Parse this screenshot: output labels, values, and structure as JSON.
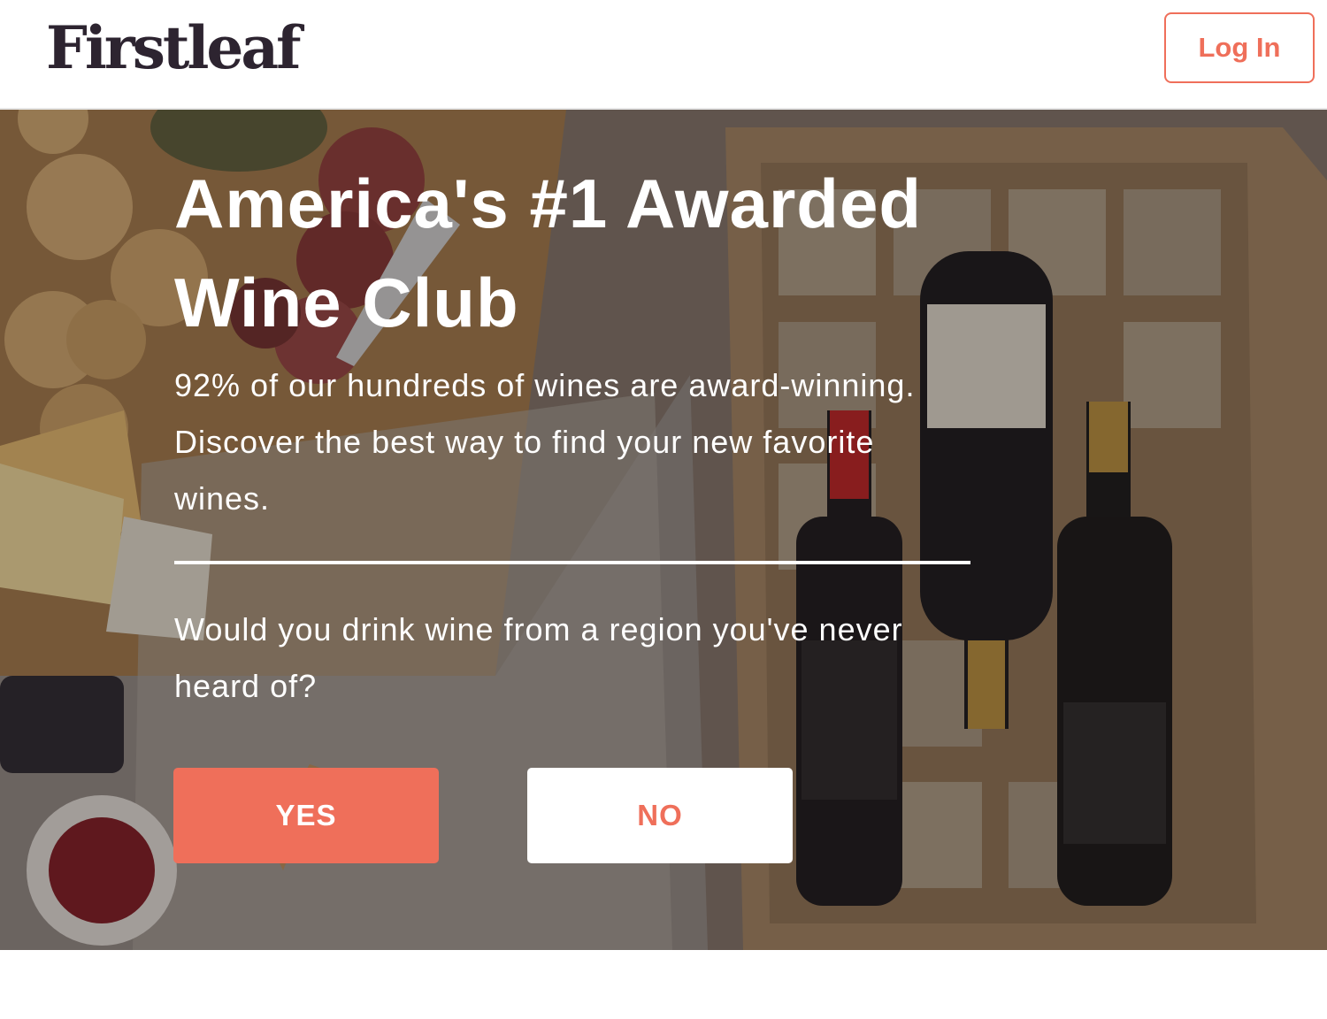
{
  "header": {
    "logo_text": "Firstleaf",
    "login_label": "Log In"
  },
  "hero": {
    "headline": "America's #1 Awarded Wine Club",
    "subtext": "92% of our hundreds of wines are award-winning. Discover the best way to find your new favorite wines.",
    "question": "Would you drink wine from a region you've never heard of?",
    "yes_label": "YES",
    "no_label": "NO",
    "background_image": "wine-box-with-bottles-and-charcuterie-board"
  },
  "colors": {
    "accent": "#ef6f5a",
    "logo": "#2d2430",
    "text_light": "#ffffff"
  }
}
